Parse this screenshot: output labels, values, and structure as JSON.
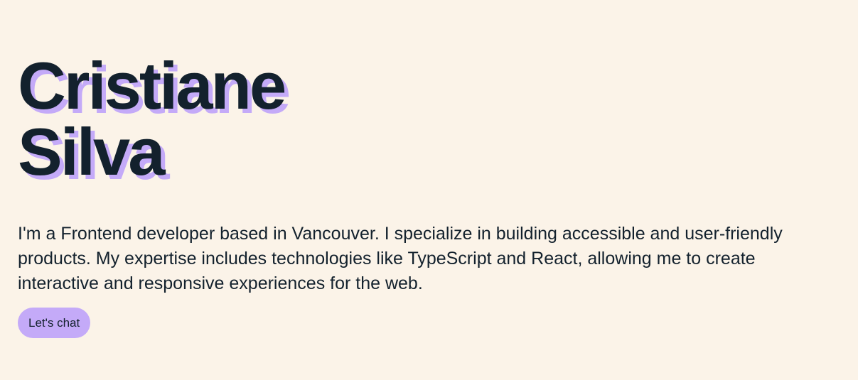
{
  "hero": {
    "name_line1": "Cristiane",
    "name_line2": "Silva",
    "bio": "I'm a Frontend developer based in Vancouver. I specialize in building accessible and user-friendly products. My expertise includes technologies like TypeScript and React, allowing me to create interactive and responsive experiences for the web.",
    "cta_label": "Let's chat"
  },
  "colors": {
    "background": "#fbf3e8",
    "text": "#13212d",
    "accent": "#c4aaf8"
  }
}
